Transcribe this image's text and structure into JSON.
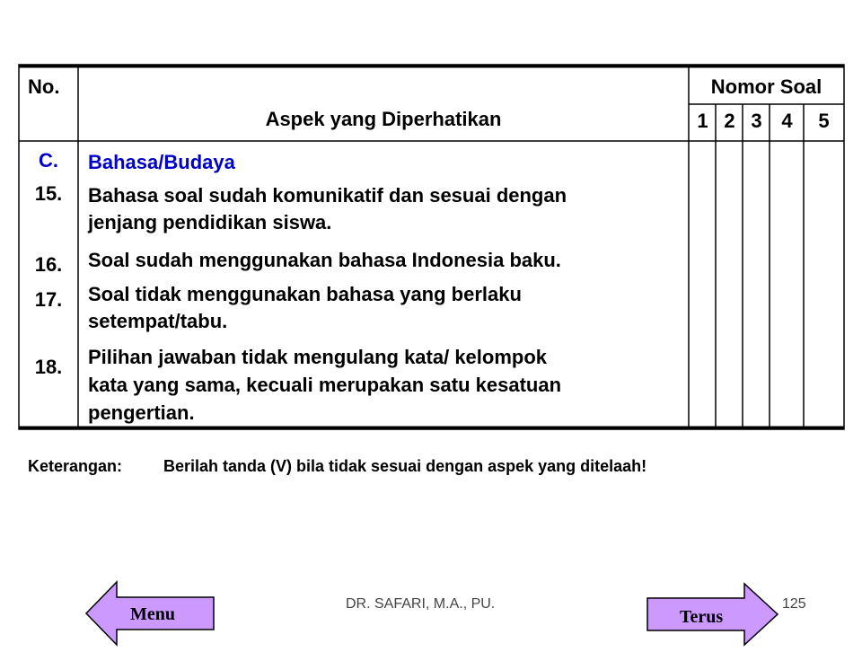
{
  "table": {
    "header_no": "No.",
    "header_aspect": "Aspek yang Diperhatikan",
    "header_question_numbers": "Nomor Soal",
    "question_columns": [
      "1",
      "2",
      "3",
      "4",
      "5"
    ],
    "section_code": "C.",
    "section_title": "Bahasa/Budaya",
    "rows": [
      {
        "no": "15.",
        "lines": [
          "Bahasa soal sudah komunikatif dan sesuai dengan",
          "jenjang pendidikan siswa."
        ]
      },
      {
        "no": "16.",
        "lines": [
          "Soal sudah menggunakan bahasa Indonesia baku."
        ]
      },
      {
        "no": "17.",
        "lines": [
          "Soal tidak menggunakan bahasa yang berlaku",
          "setempat/tabu."
        ]
      },
      {
        "no": "18.",
        "lines": [
          "Pilihan jawaban tidak mengulang kata/ kelompok",
          "kata yang sama, kecuali merupakan satu kesatuan",
          "pengertian."
        ]
      }
    ]
  },
  "note": {
    "label": "Keterangan:",
    "text": "Berilah tanda (V) bila tidak sesuai dengan aspek yang ditelaah!"
  },
  "footer": {
    "author": "DR. SAFARI, M.A., PU.",
    "page_number": "125"
  },
  "nav": {
    "menu_label": "Menu",
    "next_label": "Terus",
    "button_color": "#cc99ff"
  },
  "colors": {
    "section_code": "#0000cc"
  }
}
